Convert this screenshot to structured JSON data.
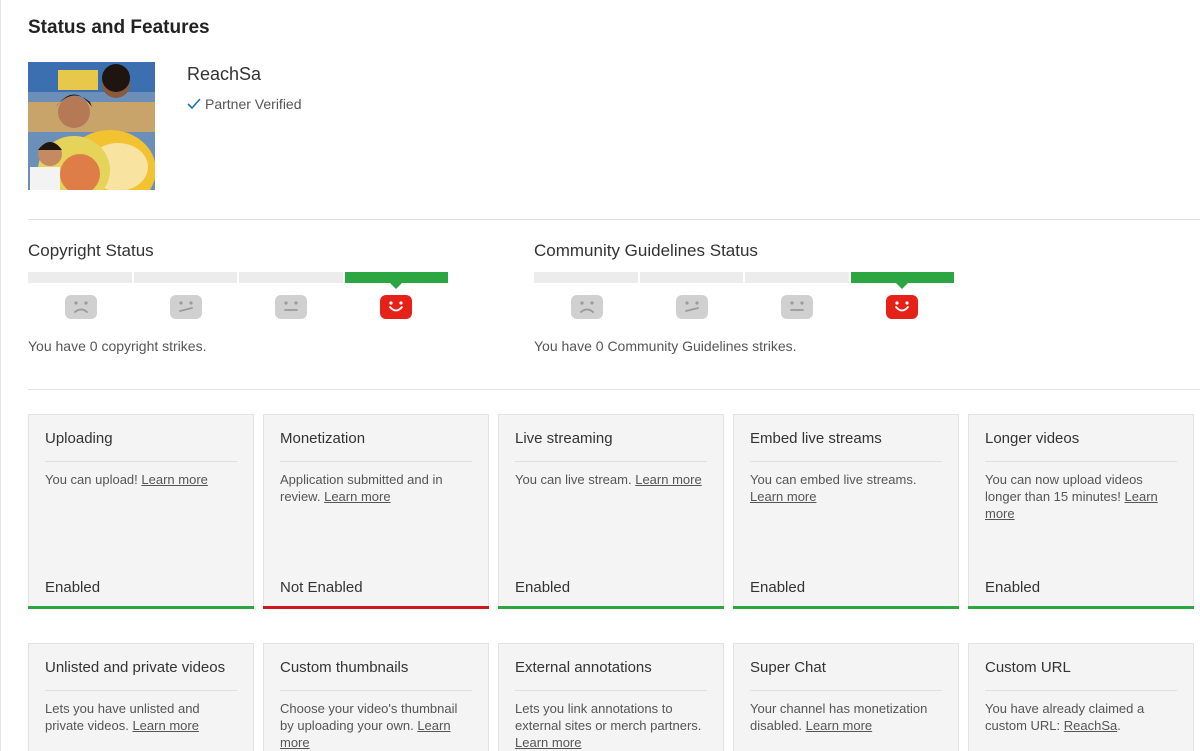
{
  "page": {
    "title": "Status and Features"
  },
  "channel": {
    "name": "ReachSa",
    "badge": "Partner Verified"
  },
  "copyright": {
    "title": "Copyright Status",
    "text": "You have 0 copyright strikes.",
    "active_segment": 4
  },
  "community": {
    "title": "Community Guidelines Status",
    "text": "You have 0 Community Guidelines strikes.",
    "active_segment": 4
  },
  "colors": {
    "enabled": "#2ba640",
    "not_enabled": "#cc181e",
    "face_active": "#e62117",
    "face_inactive": "#d0d0d0"
  },
  "features_row1": [
    {
      "title": "Uploading",
      "desc": "You can upload!",
      "link": "Learn more",
      "status": "Enabled",
      "enabled": true
    },
    {
      "title": "Monetization",
      "desc": "Application submitted and in review.",
      "link": "Learn more",
      "status": "Not Enabled",
      "enabled": false
    },
    {
      "title": "Live streaming",
      "desc": "You can live stream.",
      "link": "Learn more",
      "status": "Enabled",
      "enabled": true
    },
    {
      "title": "Embed live streams",
      "desc": "You can embed live streams.",
      "link": "Learn more",
      "status": "Enabled",
      "enabled": true
    },
    {
      "title": "Longer videos",
      "desc": "You can now upload videos longer than 15 minutes!",
      "link": "Learn more",
      "status": "Enabled",
      "enabled": true
    }
  ],
  "features_row2": [
    {
      "title": "Unlisted and private videos",
      "desc": "Lets you have unlisted and private videos.",
      "link": "Learn more"
    },
    {
      "title": "Custom thumbnails",
      "desc": "Choose your video's thumbnail by uploading your own.",
      "link": "Learn more"
    },
    {
      "title": "External annotations",
      "desc": "Lets you link annotations to external sites or merch partners.",
      "link": "Learn more"
    },
    {
      "title": "Super Chat",
      "desc": "Your channel has monetization disabled.",
      "link": "Learn more"
    },
    {
      "title": "Custom URL",
      "desc": "You have already claimed a custom URL:",
      "link": "ReachSa",
      "suffix": "."
    }
  ]
}
